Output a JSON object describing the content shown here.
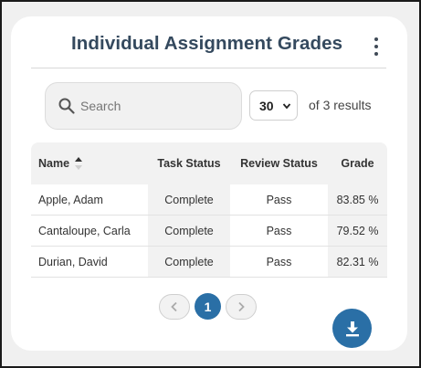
{
  "card": {
    "title": "Individual Assignment Grades"
  },
  "search": {
    "placeholder": "Search",
    "value": ""
  },
  "pagination_controls": {
    "per_page": "30",
    "results_text": "of 3 results",
    "current_page": "1"
  },
  "table": {
    "columns": [
      "Name",
      "Task Status",
      "Review Status",
      "Grade"
    ],
    "sort_column": "Name",
    "sort_direction": "ascending",
    "rows": [
      {
        "name": "Apple, Adam",
        "task_status": "Complete",
        "review_status": "Pass",
        "grade": "83.85 %"
      },
      {
        "name": "Cantaloupe, Carla",
        "task_status": "Complete",
        "review_status": "Pass",
        "grade": "79.52 %"
      },
      {
        "name": "Durian, David",
        "task_status": "Complete",
        "review_status": "Pass",
        "grade": "82.31 %"
      }
    ]
  },
  "icons": {
    "menu": "kebab-menu-icon",
    "search": "search-icon",
    "sort": "sort-ascending-icon",
    "prev": "chevron-left-icon",
    "next": "chevron-right-icon",
    "download": "download-icon"
  },
  "colors": {
    "title": "#34495e",
    "accent": "#2a6fa6",
    "table_header_bg": "#f2f2f2"
  }
}
